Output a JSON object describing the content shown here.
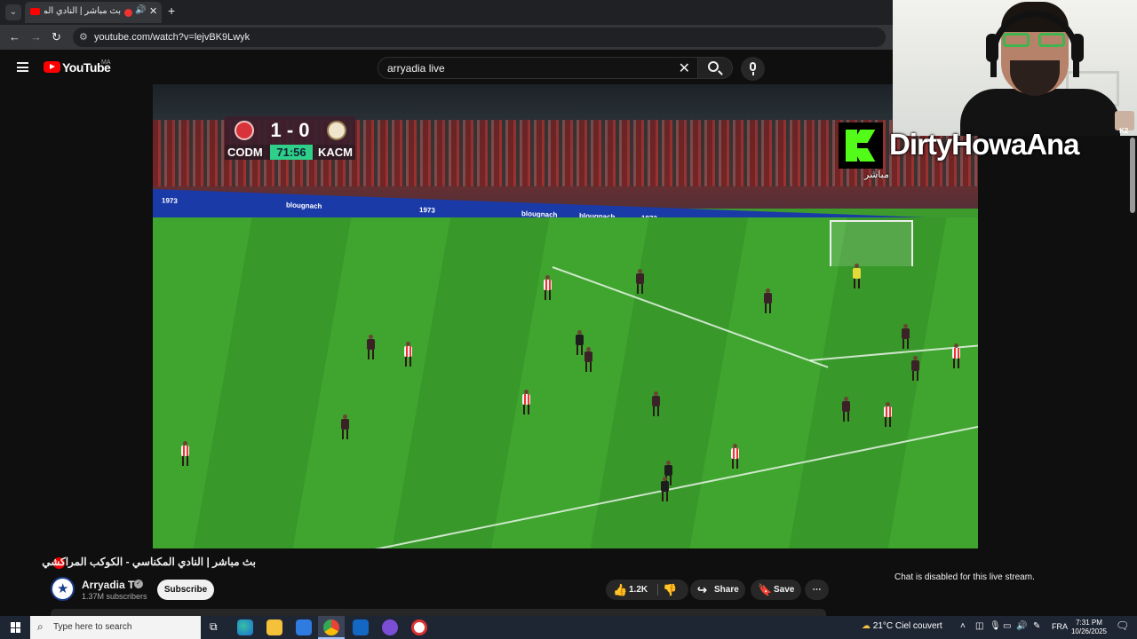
{
  "browser": {
    "tab_title": "بث مباشر | النادي المكناسي",
    "url": "youtube.com/watch?v=lejvBK9Lwyk"
  },
  "youtube": {
    "logo_text": "YouTube",
    "country_code": "MA",
    "search_query": "arryadia live"
  },
  "scoreboard": {
    "home_team": "CODM",
    "away_team": "KACM",
    "score": "1 - 0",
    "clock": "71:56"
  },
  "video_ads": {
    "board_1": "1973",
    "board_2": "blougnach",
    "board_3": "1973"
  },
  "overlay": {
    "handle": "DirtyHowaAna",
    "live_label": "مباشر",
    "badge": "K2"
  },
  "video_info": {
    "title": "بث مباشر | النادي المكناسي - الكوكب المراكشي",
    "channel_name": "Arryadia TV",
    "subscribers": "1.37M subscribers",
    "subscribe_label": "Subscribe",
    "like_count": "1.2K",
    "share_label": "Share",
    "save_label": "Save",
    "more_label": "⋯"
  },
  "chat": {
    "disabled_message": "Chat is disabled for this live stream."
  },
  "taskbar": {
    "search_placeholder": "Type here to search",
    "weather_temp": "21°C",
    "weather_desc": "Ciel couvert",
    "language": "FRA",
    "time": "7:31 PM",
    "date": "10/26/2025"
  },
  "colors": {
    "youtube_red": "#ff0000",
    "kick_green": "#53fc18",
    "clock_green": "#2ecf88"
  }
}
